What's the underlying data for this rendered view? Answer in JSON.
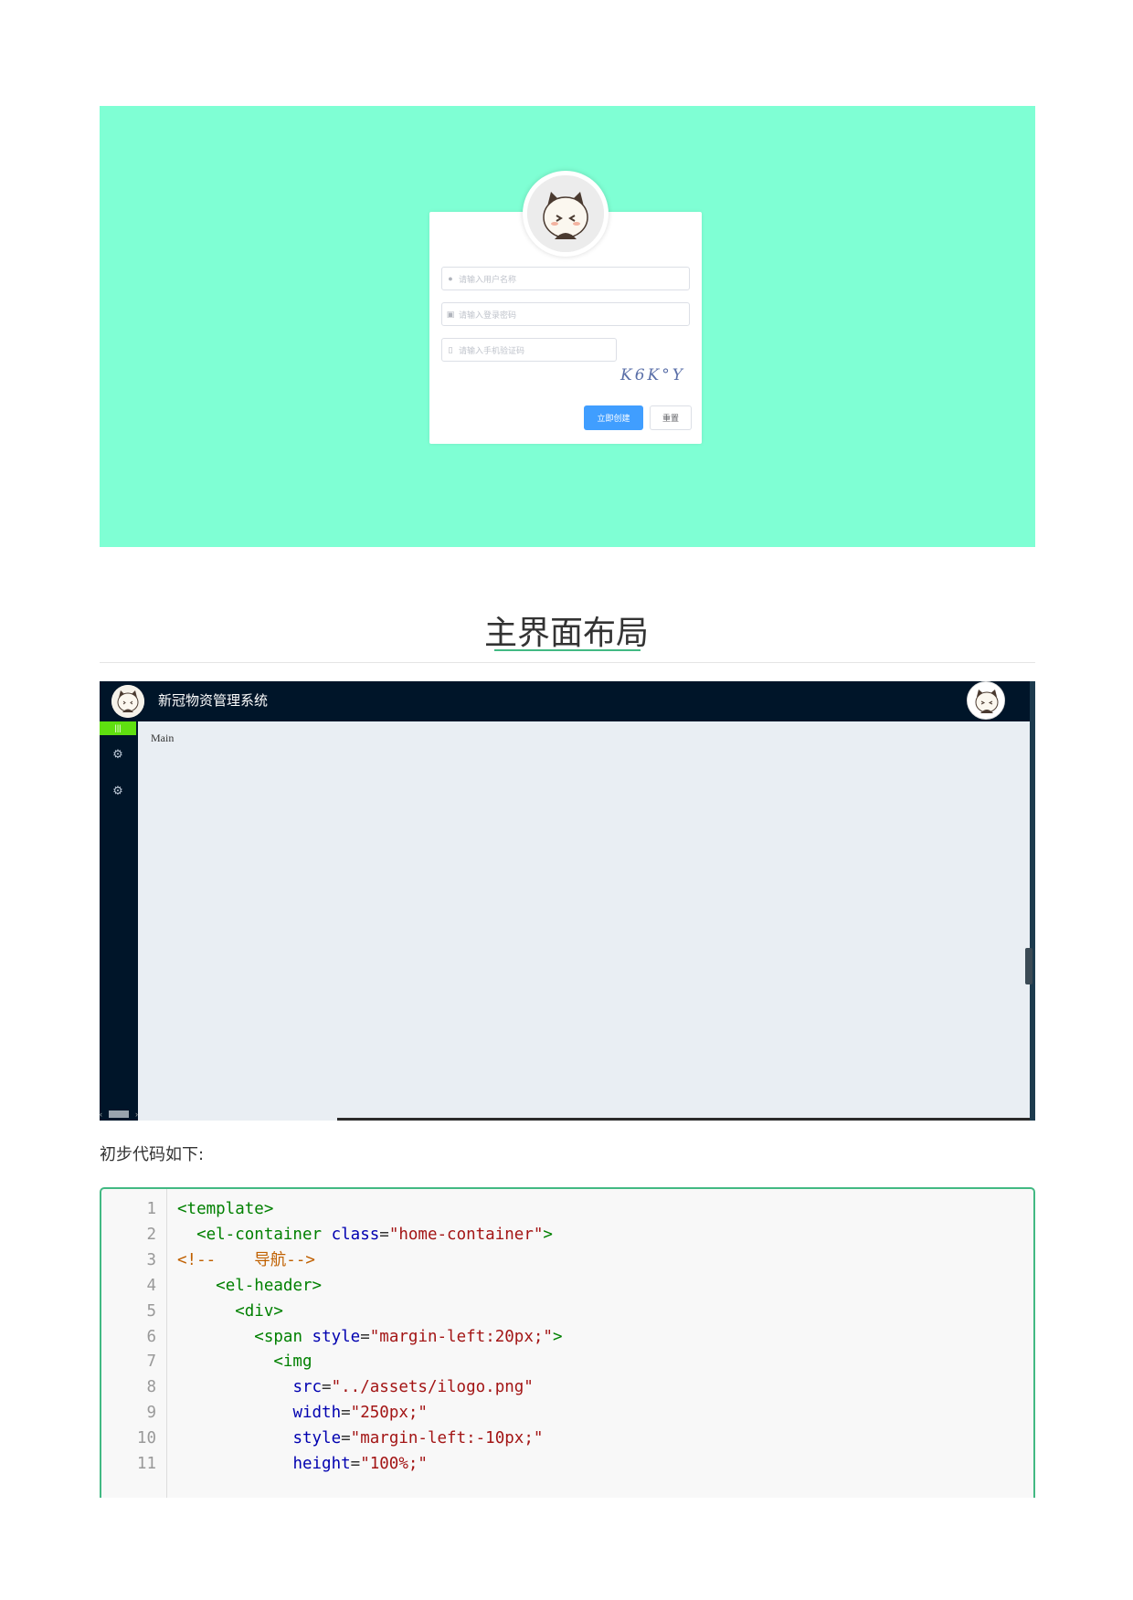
{
  "login": {
    "username_placeholder": "请输入用户名称",
    "password_placeholder": "请输入登录密码",
    "sms_placeholder": "请输入手机验证码",
    "captcha_text": "K6K°Y",
    "create_button": "立即创建",
    "reset_button": "重置",
    "background_color": "#7fffd4"
  },
  "section": {
    "title": "主界面布局"
  },
  "app": {
    "title": "新冠物资管理系统",
    "main_label": "Main",
    "toggle_label": "|||",
    "sidebar_icons": [
      "gear-icon",
      "gear-icon"
    ]
  },
  "intro_text": "初步代码如下:",
  "code": {
    "lines": [
      {
        "n": "1",
        "tokens": [
          [
            "tag",
            "<template>"
          ]
        ]
      },
      {
        "n": "2",
        "tokens": [
          [
            "pun",
            "  "
          ],
          [
            "tag",
            "<el-container"
          ],
          [
            "pun",
            " "
          ],
          [
            "attr",
            "class"
          ],
          [
            "pun",
            "="
          ],
          [
            "str",
            "\"home-container\""
          ],
          [
            "tag",
            ">"
          ]
        ]
      },
      {
        "n": "3",
        "tokens": [
          [
            "com",
            "<!--    导航-->"
          ]
        ]
      },
      {
        "n": "4",
        "tokens": [
          [
            "pun",
            "    "
          ],
          [
            "tag",
            "<el-header>"
          ]
        ]
      },
      {
        "n": "5",
        "tokens": [
          [
            "pun",
            "      "
          ],
          [
            "tag",
            "<div>"
          ]
        ]
      },
      {
        "n": "6",
        "tokens": [
          [
            "pun",
            "        "
          ],
          [
            "tag",
            "<span"
          ],
          [
            "pun",
            " "
          ],
          [
            "attr",
            "style"
          ],
          [
            "pun",
            "="
          ],
          [
            "str",
            "\"margin-left:20px;\""
          ],
          [
            "tag",
            ">"
          ]
        ]
      },
      {
        "n": "7",
        "tokens": [
          [
            "pun",
            "          "
          ],
          [
            "tag",
            "<img"
          ]
        ]
      },
      {
        "n": "8",
        "tokens": [
          [
            "pun",
            "            "
          ],
          [
            "attr",
            "src"
          ],
          [
            "pun",
            "="
          ],
          [
            "str",
            "\"../assets/ilogo.png\""
          ]
        ]
      },
      {
        "n": "9",
        "tokens": [
          [
            "pun",
            "            "
          ],
          [
            "attr",
            "width"
          ],
          [
            "pun",
            "="
          ],
          [
            "str",
            "\"250px;\""
          ]
        ]
      },
      {
        "n": "10",
        "tokens": [
          [
            "pun",
            "            "
          ],
          [
            "attr",
            "style"
          ],
          [
            "pun",
            "="
          ],
          [
            "str",
            "\"margin-left:-10px;\""
          ]
        ]
      },
      {
        "n": "11",
        "tokens": [
          [
            "pun",
            "            "
          ],
          [
            "attr",
            "height"
          ],
          [
            "pun",
            "="
          ],
          [
            "str",
            "\"100%;\""
          ]
        ]
      }
    ]
  }
}
